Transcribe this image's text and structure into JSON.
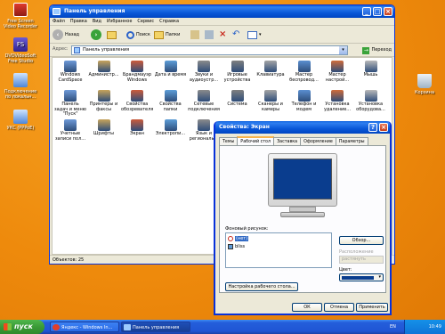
{
  "desktop": {
    "icons": [
      {
        "label": "Free Screen Video Recorder"
      },
      {
        "label": "DVDVideoSoft Free Studio"
      },
      {
        "label": "Подключение по локальн..."
      },
      {
        "label": "УКС (PPPoE)"
      },
      {
        "label": "Корзина"
      }
    ]
  },
  "window": {
    "title": "Панель управления",
    "menu": [
      "Файл",
      "Правка",
      "Вид",
      "Избранное",
      "Сервис",
      "Справка"
    ],
    "toolbar": {
      "back": "Назад",
      "search": "Поиск",
      "folders": "Папки"
    },
    "address": {
      "label": "Адрес:",
      "value": "Панель управления",
      "go": "Переход"
    },
    "items": [
      "Windows CardSpace",
      "Администр...",
      "Брандмауэр Windows",
      "Дата и время",
      "Звуки и аудиоустр...",
      "Игровые устройства",
      "Клавиатура",
      "Мастер беспровод...",
      "Мастер настрой...",
      "Мышь",
      "Панель задач и меню \"Пуск\"",
      "Принтеры и факсы",
      "Свойства обозревателя",
      "Свойства папки",
      "Сетевые подключения",
      "Система",
      "Сканеры и камеры",
      "Телефон и модем",
      "Установка удаление...",
      "Установка оборудова...",
      "Учетные записи пол...",
      "Шрифты",
      "Экран",
      "Электропи...",
      "Язык и региональ..."
    ],
    "status": "Объектов: 25"
  },
  "dialog": {
    "title": "Свойства: Экран",
    "tabs": [
      "Темы",
      "Рабочий стол",
      "Заставка",
      "Оформление",
      "Параметры"
    ],
    "active_tab": "Рабочий стол",
    "wallpaper_label": "Фоновый рисунок:",
    "wallpapers": [
      "(нет)",
      "bliss"
    ],
    "browse": "Обзор...",
    "position_label": "Расположение",
    "position_value": "растянуть",
    "color_label": "Цвет:",
    "customize": "Настройка рабочего стола...",
    "ok": "ОК",
    "cancel": "Отмена",
    "apply": "Применить",
    "preview_color": "#0a3d8e"
  },
  "taskbar": {
    "start": "пуск",
    "tasks": [
      "Яндекс - Windows In...",
      "Панель управления"
    ],
    "lang": "EN",
    "clock": "10:49"
  },
  "colors": {
    "accent": "#0831d9",
    "desktop": "#ee8a0c",
    "preview": "#0a3d8e"
  }
}
